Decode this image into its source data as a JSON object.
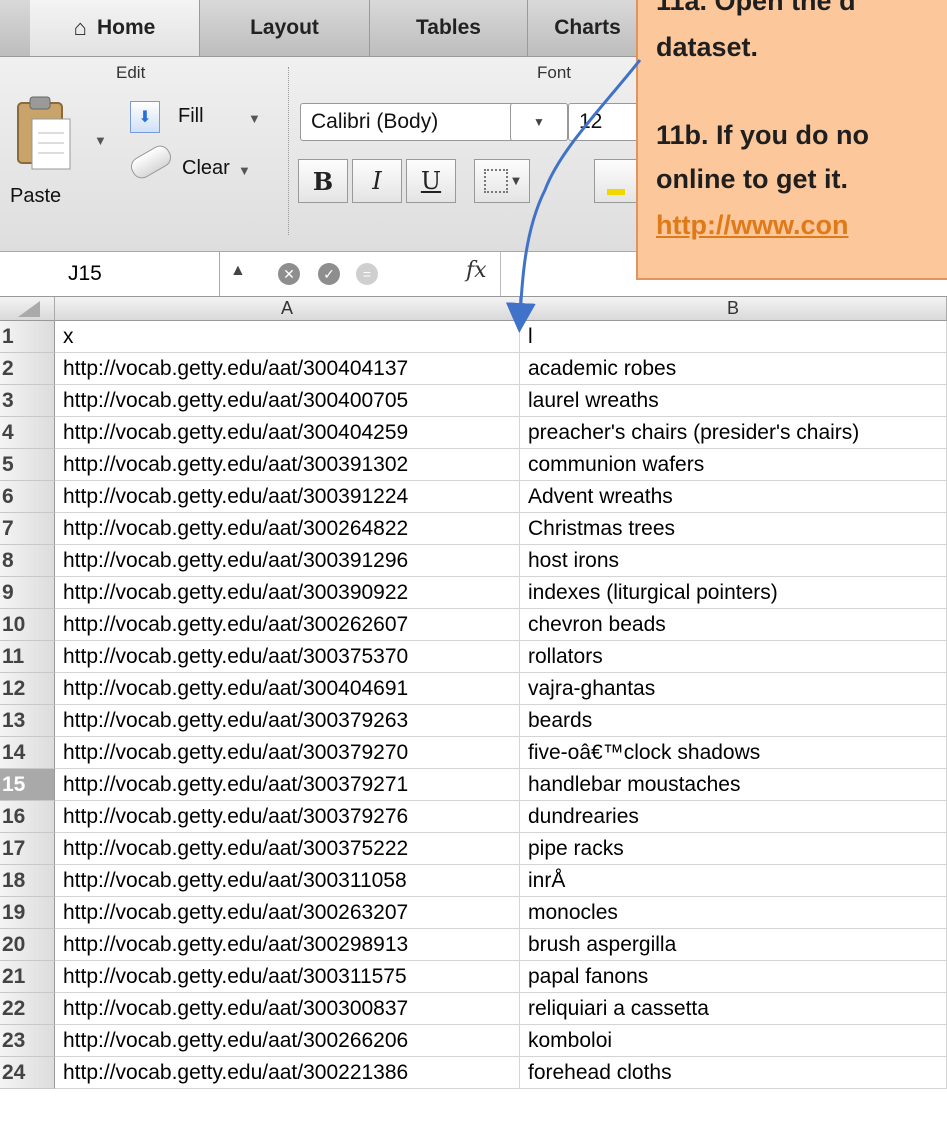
{
  "tabs": [
    {
      "label": "Home",
      "active": true
    },
    {
      "label": "Layout"
    },
    {
      "label": "Tables"
    },
    {
      "label": "Charts"
    }
  ],
  "ribbon": {
    "edit_label": "Edit",
    "font_label": "Font",
    "paste_label": "Paste",
    "fill_label": "Fill",
    "clear_label": "Clear",
    "font_name": "Calibri (Body)",
    "font_size": "12",
    "bold": "B",
    "italic": "I",
    "underline": "U"
  },
  "formula_bar": {
    "cell_ref": "J15",
    "fx": "fx"
  },
  "callout": {
    "line1": "11a. Open the d",
    "line2": "dataset.",
    "line3": "11b. If you do no",
    "line4": "online to get it.",
    "link": "http://www.con"
  },
  "sheet": {
    "columns": [
      "A",
      "B"
    ],
    "selected_row": 15,
    "rows": [
      {
        "n": "1",
        "a": "x",
        "b": "l"
      },
      {
        "n": "2",
        "a": "http://vocab.getty.edu/aat/300404137",
        "b": "academic robes"
      },
      {
        "n": "3",
        "a": "http://vocab.getty.edu/aat/300400705",
        "b": "laurel wreaths"
      },
      {
        "n": "4",
        "a": "http://vocab.getty.edu/aat/300404259",
        "b": "preacher's chairs (presider's chairs)"
      },
      {
        "n": "5",
        "a": "http://vocab.getty.edu/aat/300391302",
        "b": "communion wafers"
      },
      {
        "n": "6",
        "a": "http://vocab.getty.edu/aat/300391224",
        "b": "Advent wreaths"
      },
      {
        "n": "7",
        "a": "http://vocab.getty.edu/aat/300264822",
        "b": "Christmas trees"
      },
      {
        "n": "8",
        "a": "http://vocab.getty.edu/aat/300391296",
        "b": "host irons"
      },
      {
        "n": "9",
        "a": "http://vocab.getty.edu/aat/300390922",
        "b": "indexes (liturgical pointers)"
      },
      {
        "n": "10",
        "a": "http://vocab.getty.edu/aat/300262607",
        "b": "chevron beads"
      },
      {
        "n": "11",
        "a": "http://vocab.getty.edu/aat/300375370",
        "b": "rollators"
      },
      {
        "n": "12",
        "a": "http://vocab.getty.edu/aat/300404691",
        "b": "vajra-ghantas"
      },
      {
        "n": "13",
        "a": "http://vocab.getty.edu/aat/300379263",
        "b": "beards"
      },
      {
        "n": "14",
        "a": "http://vocab.getty.edu/aat/300379270",
        "b": "five-oâ€™clock shadows"
      },
      {
        "n": "15",
        "a": "http://vocab.getty.edu/aat/300379271",
        "b": "handlebar moustaches"
      },
      {
        "n": "16",
        "a": "http://vocab.getty.edu/aat/300379276",
        "b": "dundrearies"
      },
      {
        "n": "17",
        "a": "http://vocab.getty.edu/aat/300375222",
        "b": "pipe racks"
      },
      {
        "n": "18",
        "a": "http://vocab.getty.edu/aat/300311058",
        "b": "inrÅ"
      },
      {
        "n": "19",
        "a": "http://vocab.getty.edu/aat/300263207",
        "b": "monocles"
      },
      {
        "n": "20",
        "a": "http://vocab.getty.edu/aat/300298913",
        "b": "brush aspergilla"
      },
      {
        "n": "21",
        "a": "http://vocab.getty.edu/aat/300311575",
        "b": "papal fanons"
      },
      {
        "n": "22",
        "a": "http://vocab.getty.edu/aat/300300837",
        "b": "reliquiari a cassetta"
      },
      {
        "n": "23",
        "a": "http://vocab.getty.edu/aat/300266206",
        "b": "komboloi"
      },
      {
        "n": "24",
        "a": "http://vocab.getty.edu/aat/300221386",
        "b": "forehead cloths"
      }
    ]
  }
}
